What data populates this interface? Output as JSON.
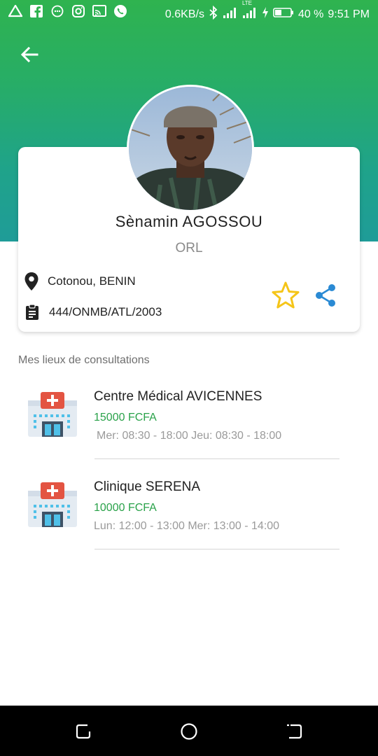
{
  "status_bar": {
    "net_speed": "0.6KB/s",
    "lte": "LTE",
    "battery": "40 %",
    "time": "9:51 PM"
  },
  "doctor": {
    "name": "Sènamin AGOSSOU",
    "specialty": "ORL",
    "location": "Cotonou, BENIN",
    "registration": "444/ONMB/ATL/2003"
  },
  "section_title": "Mes lieux de consultations",
  "places": [
    {
      "name": "Centre Médical AVICENNES",
      "price": "15000 FCFA",
      "hours": "Mer: 08:30 - 18:00 Jeu: 08:30 - 18:00"
    },
    {
      "name": "Clinique SERENA",
      "price": "10000 FCFA",
      "hours": "Lun: 12:00 - 13:00 Mer: 13:00 - 14:00"
    }
  ],
  "colors": {
    "header_top": "#2fb34f",
    "header_bottom": "#1f9c98",
    "price_green": "#2aa24a",
    "star_yellow": "#f5c518",
    "share_blue": "#2a8ad4"
  },
  "icons": {
    "back": "arrow-left-icon",
    "location": "map-pin-icon",
    "registration": "clipboard-icon",
    "favorite": "star-outline-icon",
    "share": "share-icon",
    "hospital": "hospital-icon"
  }
}
